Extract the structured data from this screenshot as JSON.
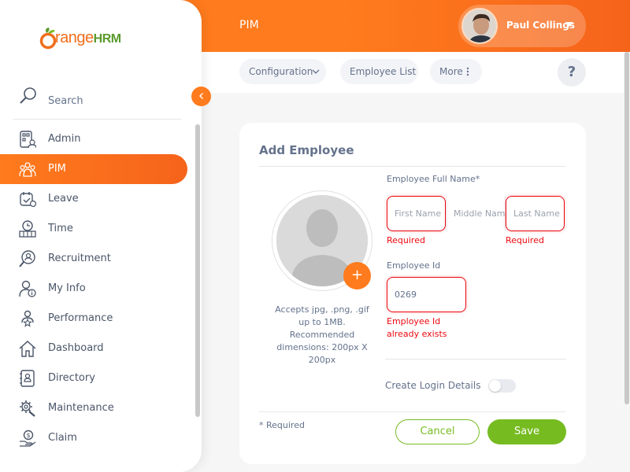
{
  "header": {
    "module_title": "PIM",
    "user_name": "Paul Collings"
  },
  "sidebar": {
    "logo_text": "range",
    "logo_hrm": "HRM",
    "search_label": "Search",
    "collapse_icon": "chevron-left-icon",
    "items": [
      {
        "label": "Admin",
        "icon": "admin-icon"
      },
      {
        "label": "PIM",
        "icon": "pim-icon",
        "active": true
      },
      {
        "label": "Leave",
        "icon": "leave-icon"
      },
      {
        "label": "Time",
        "icon": "time-icon"
      },
      {
        "label": "Recruitment",
        "icon": "recruitment-icon"
      },
      {
        "label": "My Info",
        "icon": "my-info-icon"
      },
      {
        "label": "Performance",
        "icon": "performance-icon"
      },
      {
        "label": "Dashboard",
        "icon": "dashboard-icon"
      },
      {
        "label": "Directory",
        "icon": "directory-icon"
      },
      {
        "label": "Maintenance",
        "icon": "maintenance-icon"
      },
      {
        "label": "Claim",
        "icon": "claim-icon"
      }
    ]
  },
  "topnav": {
    "configuration": "Configuration",
    "employee_list": "Employee List",
    "more": "More",
    "help": "?"
  },
  "form": {
    "title": "Add Employee",
    "photo_hint": "Accepts jpg, .png, .gif up to 1MB. Recommended dimensions: 200px X 200px",
    "add_photo": "+",
    "full_name_label": "Employee Full Name*",
    "first_name_placeholder": "First Name",
    "middle_name_placeholder": "Middle Name",
    "last_name_placeholder": "Last Name",
    "first_name_error": "Required",
    "last_name_error": "Required",
    "employee_id_label": "Employee Id",
    "employee_id_value": "0269",
    "employee_id_error": "Employee Id already exists",
    "create_login_label": "Create Login Details",
    "create_login_enabled": false,
    "required_note": "* Required",
    "cancel": "Cancel",
    "save": "Save"
  },
  "colors": {
    "brand_orange": "#ff7b1d",
    "accent_green": "#76bc21",
    "error_red": "#eb0910"
  }
}
